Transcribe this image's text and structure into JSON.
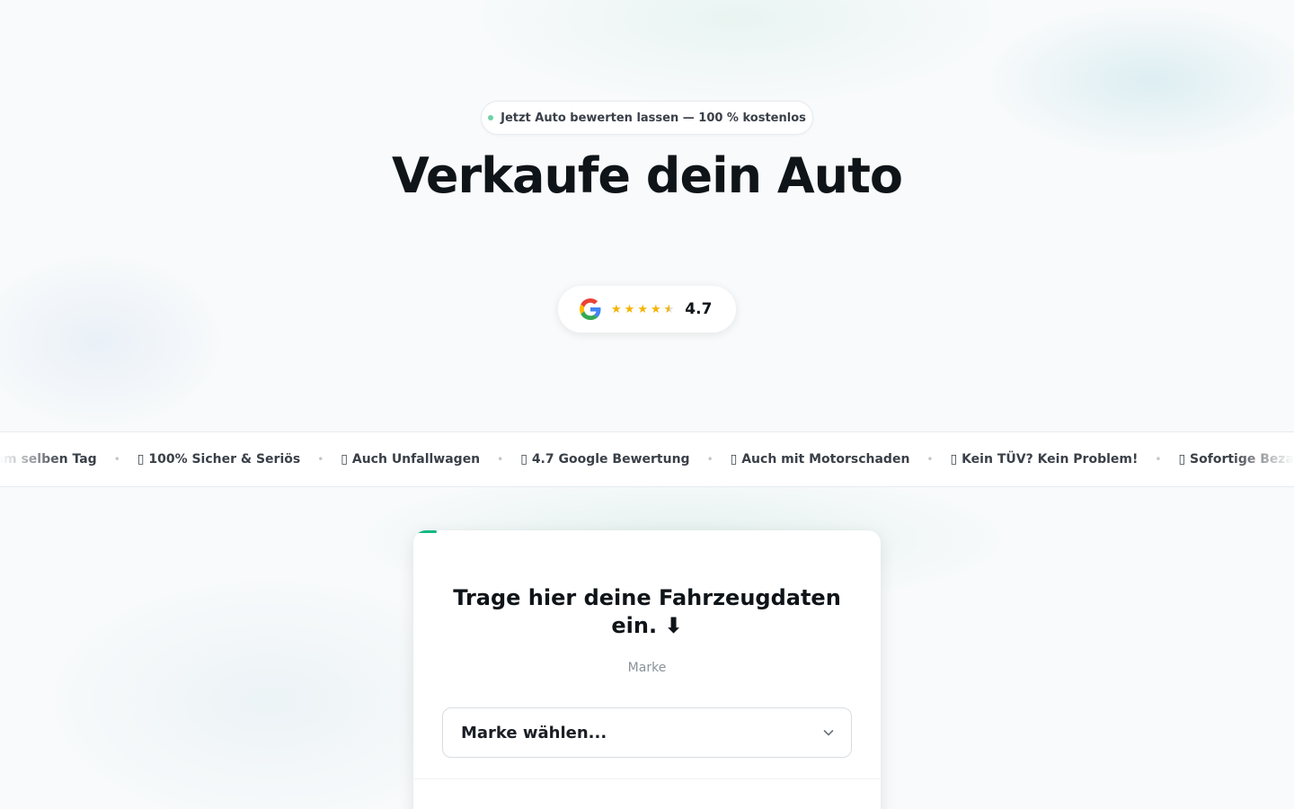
{
  "hero": {
    "pill_text": "Jetzt Auto bewerten lassen — 100 % kostenlos",
    "headline": "Verkaufe dein Auto",
    "rating": {
      "logo_icon": "google-icon",
      "stars": 4.7,
      "score": "4.7",
      "star_color": "#f5b400"
    }
  },
  "ticker": {
    "items": [
      {
        "icon": "box-glyph",
        "text": "Auszahlung am selben Tag",
        "visible_text": "t am selben Tag"
      },
      {
        "icon": "box-glyph",
        "text": "100% Sicher & Seriös",
        "visible_text": "▯ 100% Sicher & Seriös"
      },
      {
        "icon": "box-glyph",
        "text": "Auch Unfallwagen",
        "visible_text": "▯ Auch Unfallwagen"
      },
      {
        "icon": "box-glyph",
        "text": "4.7 Google Bewertung",
        "visible_text": "▯ 4.7 Google Bewertung"
      },
      {
        "icon": "box-glyph",
        "text": "Auch mit Motorschaden",
        "visible_text": "▯ Auch mit Motorschaden"
      },
      {
        "icon": "box-glyph",
        "text": "Kein TÜV? Kein Problem!",
        "visible_text": "▯ Kein TÜV? Kein Problem!"
      },
      {
        "icon": "box-glyph",
        "text": "Sofortige Bezahlung",
        "visible_text": "▯ Sofortige Bezahlung"
      }
    ],
    "separator": "•"
  },
  "form": {
    "progress": 0.05,
    "accent_color": "#10b981",
    "title": "Trage hier deine Fahrzeugdaten ein. ⬇",
    "brand_label": "Marke",
    "brand_select_value": "Marke wählen..."
  }
}
